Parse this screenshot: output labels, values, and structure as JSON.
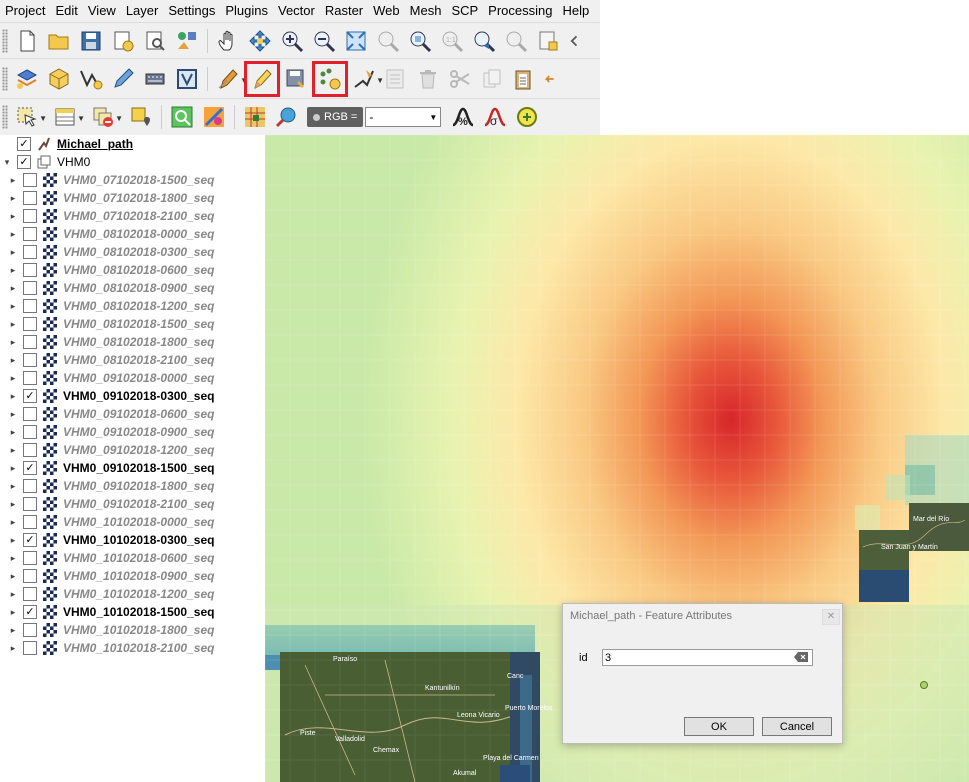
{
  "menubar": {
    "items": [
      "Project",
      "Edit",
      "View",
      "Layer",
      "Settings",
      "Plugins",
      "Vector",
      "Raster",
      "Web",
      "Mesh",
      "SCP",
      "Processing",
      "Help"
    ]
  },
  "toolbar1": {
    "icons": [
      "new-project-icon",
      "open-project-icon",
      "save-project-icon",
      "new-print-layout-icon",
      "layout-manager-icon",
      "style-manager-icon",
      "pan-icon",
      "pan-to-selection-icon",
      "zoom-in-icon",
      "zoom-out-icon",
      "zoom-full-icon",
      "zoom-to-selection-icon",
      "zoom-to-layer-icon",
      "zoom-native-icon",
      "zoom-last-icon",
      "zoom-next-icon",
      "new-bookmark-icon",
      "show-bookmarks-icon"
    ]
  },
  "toolbar2": {
    "icons": [
      "data-source-manager-icon",
      "new-geopackage-icon",
      "new-shapefile-icon",
      "digitize-icon",
      "gps-icon",
      "virtual-layer-icon",
      "current-edits-icon",
      "toggle-editing-icon",
      "save-edits-icon",
      "add-point-feature-icon",
      "vertex-tool-icon",
      "modify-attributes-icon",
      "delete-selected-icon",
      "cut-features-icon",
      "copy-features-icon",
      "paste-features-icon",
      "undo-icon"
    ]
  },
  "toolbar3": {
    "icons": [
      "select-features-icon",
      "attribute-table-icon",
      "deselect-icon",
      "identify-icon",
      "scp-toggle-icon",
      "scp-dock-icon",
      "roi-icon",
      "scp-zoom-icon"
    ],
    "rgb_label": "RGB =",
    "rgb_value": "-"
  },
  "layers": [
    {
      "name": "Michael_path",
      "checked": true,
      "type": "vector",
      "expand": "",
      "style": "group"
    },
    {
      "name": "VHM0",
      "checked": true,
      "type": "group",
      "expand": "▾",
      "style": "plain"
    },
    {
      "name": "VHM0_07102018-1500_seq",
      "checked": false,
      "type": "raster",
      "expand": "▸",
      "style": "off"
    },
    {
      "name": "VHM0_07102018-1800_seq",
      "checked": false,
      "type": "raster",
      "expand": "▸",
      "style": "off"
    },
    {
      "name": "VHM0_07102018-2100_seq",
      "checked": false,
      "type": "raster",
      "expand": "▸",
      "style": "off"
    },
    {
      "name": "VHM0_08102018-0000_seq",
      "checked": false,
      "type": "raster",
      "expand": "▸",
      "style": "off"
    },
    {
      "name": "VHM0_08102018-0300_seq",
      "checked": false,
      "type": "raster",
      "expand": "▸",
      "style": "off"
    },
    {
      "name": "VHM0_08102018-0600_seq",
      "checked": false,
      "type": "raster",
      "expand": "▸",
      "style": "off"
    },
    {
      "name": "VHM0_08102018-0900_seq",
      "checked": false,
      "type": "raster",
      "expand": "▸",
      "style": "off"
    },
    {
      "name": "VHM0_08102018-1200_seq",
      "checked": false,
      "type": "raster",
      "expand": "▸",
      "style": "off"
    },
    {
      "name": "VHM0_08102018-1500_seq",
      "checked": false,
      "type": "raster",
      "expand": "▸",
      "style": "off"
    },
    {
      "name": "VHM0_08102018-1800_seq",
      "checked": false,
      "type": "raster",
      "expand": "▸",
      "style": "off"
    },
    {
      "name": "VHM0_08102018-2100_seq",
      "checked": false,
      "type": "raster",
      "expand": "▸",
      "style": "off"
    },
    {
      "name": "VHM0_09102018-0000_seq",
      "checked": false,
      "type": "raster",
      "expand": "▸",
      "style": "off"
    },
    {
      "name": "VHM0_09102018-0300_seq",
      "checked": true,
      "type": "raster",
      "expand": "▸",
      "style": "on"
    },
    {
      "name": "VHM0_09102018-0600_seq",
      "checked": false,
      "type": "raster",
      "expand": "▸",
      "style": "off"
    },
    {
      "name": "VHM0_09102018-0900_seq",
      "checked": false,
      "type": "raster",
      "expand": "▸",
      "style": "off"
    },
    {
      "name": "VHM0_09102018-1200_seq",
      "checked": false,
      "type": "raster",
      "expand": "▸",
      "style": "off"
    },
    {
      "name": "VHM0_09102018-1500_seq",
      "checked": true,
      "type": "raster",
      "expand": "▸",
      "style": "on"
    },
    {
      "name": "VHM0_09102018-1800_seq",
      "checked": false,
      "type": "raster",
      "expand": "▸",
      "style": "off"
    },
    {
      "name": "VHM0_09102018-2100_seq",
      "checked": false,
      "type": "raster",
      "expand": "▸",
      "style": "off"
    },
    {
      "name": "VHM0_10102018-0000_seq",
      "checked": false,
      "type": "raster",
      "expand": "▸",
      "style": "off"
    },
    {
      "name": "VHM0_10102018-0300_seq",
      "checked": true,
      "type": "raster",
      "expand": "▸",
      "style": "on"
    },
    {
      "name": "VHM0_10102018-0600_seq",
      "checked": false,
      "type": "raster",
      "expand": "▸",
      "style": "off"
    },
    {
      "name": "VHM0_10102018-0900_seq",
      "checked": false,
      "type": "raster",
      "expand": "▸",
      "style": "off"
    },
    {
      "name": "VHM0_10102018-1200_seq",
      "checked": false,
      "type": "raster",
      "expand": "▸",
      "style": "off"
    },
    {
      "name": "VHM0_10102018-1500_seq",
      "checked": true,
      "type": "raster",
      "expand": "▸",
      "style": "on"
    },
    {
      "name": "VHM0_10102018-1800_seq",
      "checked": false,
      "type": "raster",
      "expand": "▸",
      "style": "off"
    },
    {
      "name": "VHM0_10102018-2100_seq",
      "checked": false,
      "type": "raster",
      "expand": "▸",
      "style": "off"
    }
  ],
  "map": {
    "place_labels": [
      "Paraíso",
      "Valladolid",
      "Kantunilkín",
      "Leona Vicario",
      "Puerto Morelos",
      "Playa del Carmen",
      "Akumal",
      "Piste",
      "Chemax",
      "Canc",
      "Mar del Río",
      "San Juan y Martín"
    ]
  },
  "dialog": {
    "title": "Michael_path - Feature Attributes",
    "field_label": "id",
    "field_value": "3",
    "ok_label": "OK",
    "cancel_label": "Cancel"
  },
  "colors": {
    "highlight": "#e0202a",
    "heat_max": "#d7262a"
  }
}
